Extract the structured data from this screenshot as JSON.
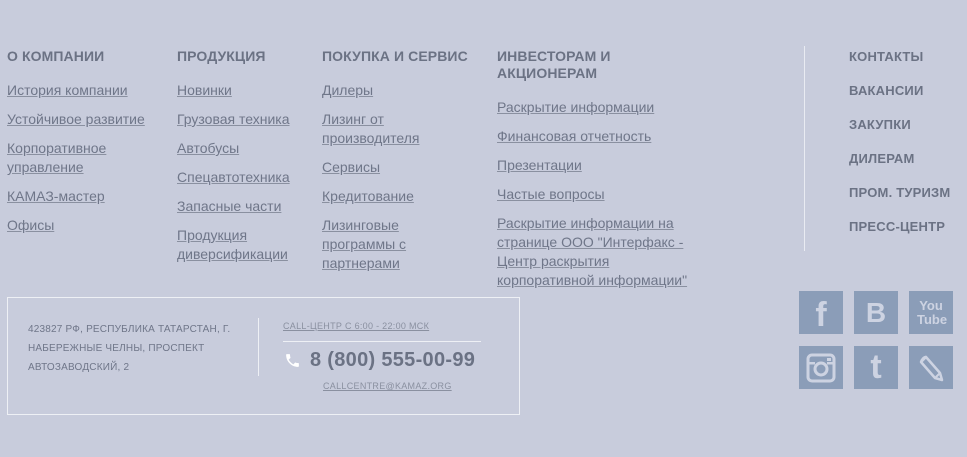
{
  "columns": [
    {
      "title": "О КОМПАНИИ",
      "links": [
        "История компании",
        "Устойчивое развитие",
        "Корпоративное управление",
        "КАМАЗ-мастер",
        "Офисы"
      ]
    },
    {
      "title": "ПРОДУКЦИЯ",
      "links": [
        "Новинки",
        "Грузовая техника",
        "Автобусы",
        "Спецавтотехника",
        "Запасные части",
        "Продукция диверсификации"
      ]
    },
    {
      "title": "ПОКУПКА И СЕРВИС",
      "links": [
        "Дилеры",
        "Лизинг от производителя",
        "Сервисы",
        "Кредитование",
        "Лизинговые программы с партнерами"
      ]
    },
    {
      "title": "ИНВЕСТОРАМ И АКЦИОНЕРАМ",
      "links": [
        "Раскрытие информации",
        "Финансовая отчетность",
        "Презентации",
        "Частые вопросы",
        "Раскрытие информации на странице ООО \"Интерфакс - Центр раскрытия корпоративной информации\""
      ]
    }
  ],
  "right_nav": [
    "КОНТАКТЫ",
    "ВАКАНСИИ",
    "ЗАКУПКИ",
    "ДИЛЕРАМ",
    "ПРОМ. ТУРИЗМ",
    "ПРЕСС-ЦЕНТР"
  ],
  "contact": {
    "address": "423827 РФ, Республика Татарстан, г. Набережные Челны, проспект Автозаводский, 2",
    "call_label": "CALL-ЦЕНТР С 6:00 - 22:00 МСК",
    "phone": "8 (800) 555-00-99",
    "email": "CALLCENTRE@KAMAZ.ORG"
  },
  "social": [
    {
      "name": "facebook-icon",
      "glyph": "f"
    },
    {
      "name": "vkontakte-icon",
      "glyph": "B"
    },
    {
      "name": "youtube-icon",
      "glyph": "You Tube"
    },
    {
      "name": "instagram-icon",
      "glyph": ""
    },
    {
      "name": "tumblr-icon",
      "glyph": "t"
    },
    {
      "name": "livejournal-icon",
      "glyph": ""
    }
  ],
  "colors": {
    "background": "#c8ccdc",
    "text": "#6b7284",
    "social_bg": "#8b9db8"
  }
}
